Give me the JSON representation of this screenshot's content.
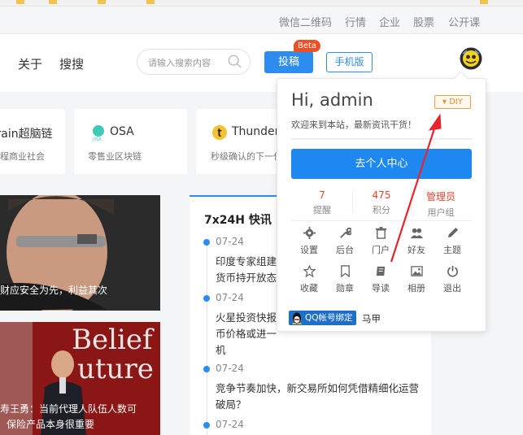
{
  "top_links": [
    "微信二维码",
    "行情",
    "企业",
    "股票",
    "公开课"
  ],
  "nav": {
    "links": [
      "关于",
      "搜搜"
    ],
    "search_placeholder": "请输入搜索内容",
    "submit_label": "投稿",
    "beta_badge": "Beta",
    "mobile_label": "手机版"
  },
  "chains": [
    {
      "name": "train超脑链",
      "desc": "程商业社会"
    },
    {
      "name": "OSA",
      "logo_text": "OSA",
      "desc": "零售业区块链"
    },
    {
      "name": "ThunderC",
      "desc": "秒级确认的下一代"
    }
  ],
  "news": [
    {
      "caption": "财应安全为先，利益其次"
    },
    {
      "bg_text": [
        "Belief",
        "uture"
      ],
      "caption_lines": [
        "寿王勇：当前代理人队伍人数可",
        "保险产品本身很重要"
      ]
    }
  ],
  "flash": {
    "title": "7x24H 快讯",
    "items": [
      {
        "time": "07-24",
        "text": "印度专家组建议\n货币持开放态度"
      },
      {
        "time": "07-24",
        "text": "火星投资快报\n币价格或进一\n机"
      },
      {
        "time": "07-24",
        "text": "竞争节奏加快，新交易所如何凭借精细化运营\n破局？"
      },
      {
        "time": "07-24",
        "text": ""
      }
    ]
  },
  "popup": {
    "greeting": "Hi, admin",
    "diy_label": "DIY",
    "welcome": "欢迎来到本站，最新资讯干货！",
    "center_button": "去个人中心",
    "stats": [
      {
        "value": "7",
        "label": "提醒",
        "color": "#e8452c"
      },
      {
        "value": "475",
        "label": "积分",
        "color": "#e8452c"
      },
      {
        "value": "管理员",
        "label": "用户组",
        "color": "#e8452c"
      }
    ],
    "shortcuts": [
      {
        "label": "设置",
        "icon": "gear-icon"
      },
      {
        "label": "后台",
        "icon": "wrench-icon"
      },
      {
        "label": "门户",
        "icon": "trash-icon"
      },
      {
        "label": "好友",
        "icon": "users-icon"
      },
      {
        "label": "主题",
        "icon": "pencil-icon"
      },
      {
        "label": "收藏",
        "icon": "star-icon"
      },
      {
        "label": "勋章",
        "icon": "bookmark-icon"
      },
      {
        "label": "导读",
        "icon": "book-icon"
      },
      {
        "label": "相册",
        "icon": "image-icon"
      },
      {
        "label": "退出",
        "icon": "power-icon"
      }
    ],
    "qq_bind": "QQ帐号绑定",
    "qq_name": "马甲"
  },
  "colors": {
    "accent": "#2d8cf0",
    "button_blue": "#1e88f0",
    "beta_red": "#f04e23",
    "annotation_red": "#e8242c",
    "diy_orange": "#f08a24"
  }
}
